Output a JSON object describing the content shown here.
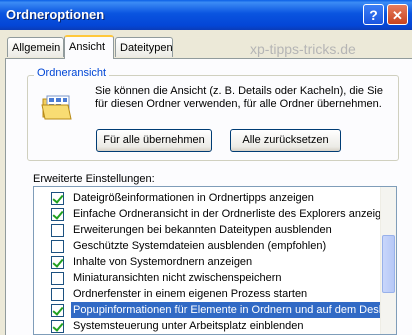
{
  "window": {
    "title": "Ordneroptionen",
    "help_glyph": "?",
    "close_glyph": "✕"
  },
  "tabs": [
    {
      "label": "Allgemein"
    },
    {
      "label": "Ansicht",
      "active": true
    },
    {
      "label": "Dateitypen"
    }
  ],
  "watermark": "xp-tipps-tricks.de",
  "folder_view": {
    "group_label": "Ordneransicht",
    "description": "Sie können die Ansicht (z. B. Details oder Kacheln), die Sie für diesen Ordner verwenden, für alle Ordner übernehmen.",
    "apply_all_label": "Für alle übernehmen",
    "reset_all_label": "Alle zurücksetzen"
  },
  "advanced": {
    "label": "Erweiterte Einstellungen:",
    "items": [
      {
        "text": "Dateigrößeinformationen in Ordnertipps anzeigen",
        "checked": true
      },
      {
        "text": "Einfache Ordneransicht in der Ordnerliste des Explorers anzeigen",
        "checked": true
      },
      {
        "text": "Erweiterungen bei bekannten Dateitypen ausblenden",
        "checked": false
      },
      {
        "text": "Geschützte Systemdateien ausblenden (empfohlen)",
        "checked": false
      },
      {
        "text": "Inhalte von Systemordnern anzeigen",
        "checked": true
      },
      {
        "text": "Miniaturansichten nicht zwischenspeichern",
        "checked": false
      },
      {
        "text": "Ordnerfenster in einem eigenen Prozess starten",
        "checked": false
      },
      {
        "text": "Popupinformationen für Elemente in Ordnern und auf dem Desktop",
        "checked": true,
        "selected": true
      },
      {
        "text": "Systemsteuerung unter Arbeitsplatz einblenden",
        "checked": true
      }
    ]
  },
  "colors": {
    "title_bar": "#0a54e0",
    "selection": "#316ac5",
    "group_label": "#0046d5"
  }
}
